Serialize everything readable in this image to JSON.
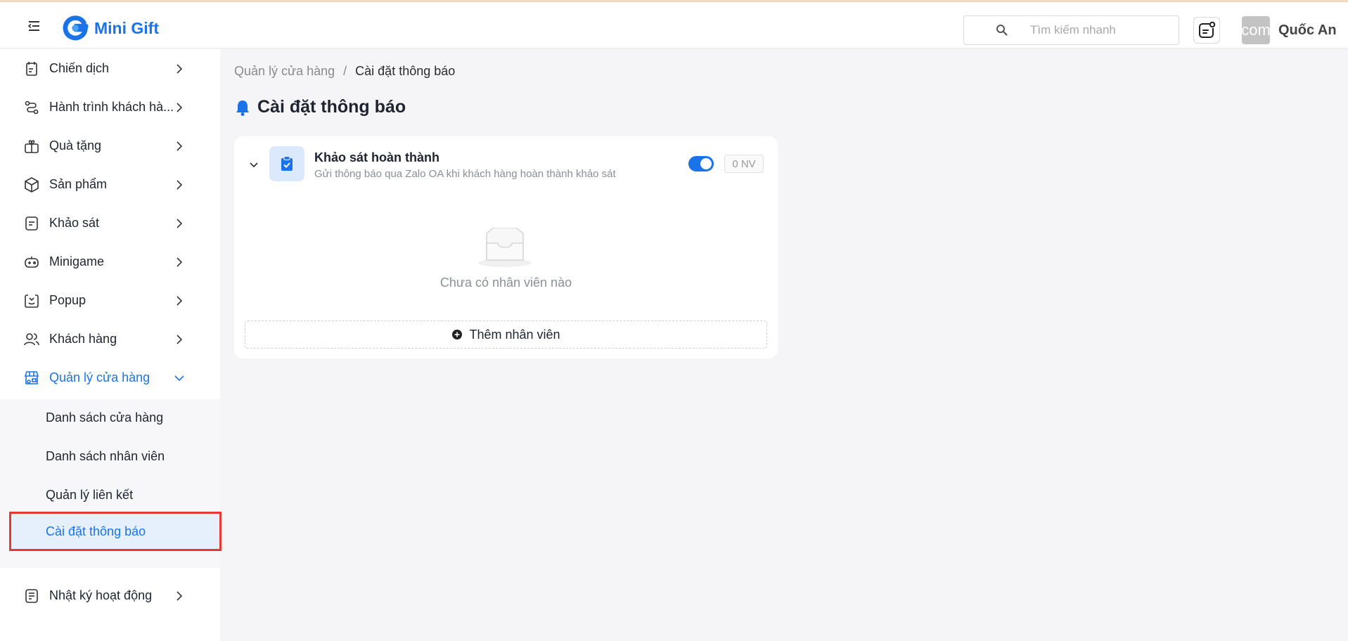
{
  "header": {
    "app_name": "Mini Gift",
    "search_placeholder": "Tìm kiếm nhanh",
    "avatar_text": "com",
    "user_name": "Quốc An"
  },
  "sidebar": {
    "items": [
      {
        "label": "Chiến dịch",
        "icon": "campaign-icon"
      },
      {
        "label": "Hành trình khách hà...",
        "icon": "route-icon"
      },
      {
        "label": "Quà tặng",
        "icon": "gift-icon"
      },
      {
        "label": "Sản phẩm",
        "icon": "box-icon"
      },
      {
        "label": "Khảo sát",
        "icon": "survey-icon"
      },
      {
        "label": "Minigame",
        "icon": "gamepad-icon"
      },
      {
        "label": "Popup",
        "icon": "popup-icon"
      },
      {
        "label": "Khách hàng",
        "icon": "users-icon"
      },
      {
        "label": "Quản lý cửa hàng",
        "icon": "store-icon",
        "expanded": true
      },
      {
        "label": "Nhật ký hoạt động",
        "icon": "log-icon"
      }
    ],
    "submenu": [
      {
        "label": "Danh sách cửa hàng"
      },
      {
        "label": "Danh sách nhân viên"
      },
      {
        "label": "Quản lý liên kết"
      },
      {
        "label": "Cài đặt thông báo",
        "selected": true
      }
    ]
  },
  "breadcrumb": {
    "parent": "Quản lý cửa hàng",
    "separator": "/",
    "current": "Cài đặt thông báo"
  },
  "page": {
    "title": "Cài đặt thông báo"
  },
  "card": {
    "title": "Khảo sát hoàn thành",
    "description": "Gửi thông báo qua Zalo OA khi khách hàng hoàn thành khảo sát",
    "enabled": true,
    "count_label": "0 NV",
    "empty_text": "Chưa có nhân viên nào",
    "add_label": "Thêm nhân viên"
  },
  "colors": {
    "accent": "#1a73e8",
    "highlight_border": "#e53935",
    "selected_bg": "#e6f0fd"
  }
}
